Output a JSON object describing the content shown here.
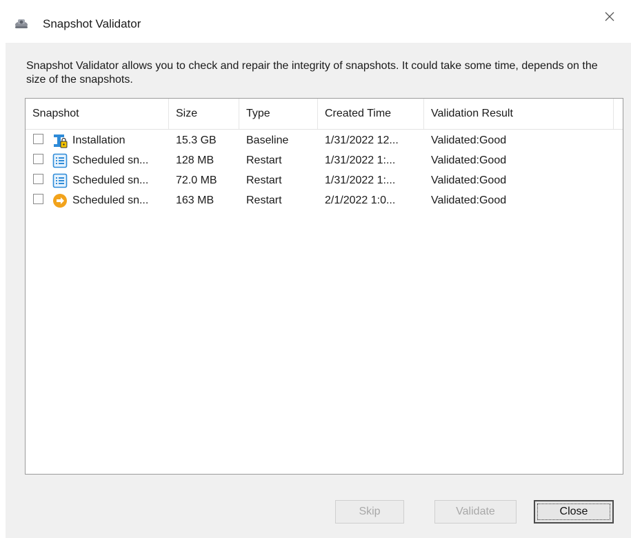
{
  "window": {
    "title": "Snapshot Validator",
    "icon": "snapshot-camera-icon",
    "close_glyph": "×"
  },
  "description": "Snapshot Validator allows you to check and repair the integrity of snapshots. It could take some time, depends on the size of the snapshots.",
  "table": {
    "columns": [
      "Snapshot",
      "Size",
      "Type",
      "Created Time",
      "Validation Result"
    ],
    "rows": [
      {
        "checked": false,
        "icon": "installation-lock-icon",
        "name": "Installation",
        "size": "15.3 GB",
        "type": "Baseline",
        "created": "1/31/2022 12...",
        "result": "Validated:Good"
      },
      {
        "checked": false,
        "icon": "scheduled-list-icon",
        "name": "Scheduled sn...",
        "size": "128 MB",
        "type": "Restart",
        "created": "1/31/2022 1:...",
        "result": "Validated:Good"
      },
      {
        "checked": false,
        "icon": "scheduled-list-icon",
        "name": "Scheduled sn...",
        "size": "72.0 MB",
        "type": "Restart",
        "created": "1/31/2022 1:...",
        "result": "Validated:Good"
      },
      {
        "checked": false,
        "icon": "restart-arrow-icon",
        "name": "Scheduled sn...",
        "size": "163 MB",
        "type": "Restart",
        "created": "2/1/2022 1:0...",
        "result": "Validated:Good"
      }
    ]
  },
  "buttons": {
    "skip": {
      "label": "Skip",
      "enabled": false
    },
    "validate": {
      "label": "Validate",
      "enabled": false
    },
    "close": {
      "label": "Close",
      "enabled": true
    }
  },
  "colors": {
    "client_bg": "#f0f0f0",
    "icon_blue": "#2e8bd8",
    "icon_orange": "#f2a31c",
    "lock_yellow": "#f5c400"
  }
}
